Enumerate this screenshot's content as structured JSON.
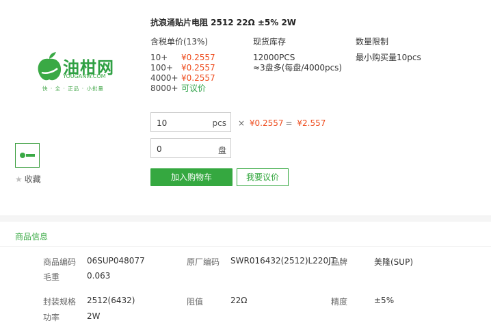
{
  "brand": {
    "name": "油柑网",
    "domain": "YOUGANW.COM",
    "slogan": "快 · 全 · 正品 · 小批量"
  },
  "product": {
    "title": "抗浪涌贴片电阻 2512 22Ω ±5% 2W"
  },
  "columns": {
    "price_head": "含税单价(13%)",
    "stock_head": "现货库存",
    "limit_head": "数量限制"
  },
  "price_tiers": [
    {
      "qty": "10+",
      "price": "¥0.2557"
    },
    {
      "qty": "100+",
      "price": "¥0.2557"
    },
    {
      "qty": "4000+",
      "price": "¥0.2557"
    },
    {
      "qty": "8000+",
      "price": "可议价"
    }
  ],
  "stock": {
    "count": "12000PCS",
    "reels": "≈3盘多(每盘/4000pcs)"
  },
  "limit": {
    "text": "最小购买量10pcs"
  },
  "order": {
    "qty_value": "10",
    "qty_unit": "pcs",
    "reel_value": "0",
    "reel_unit": "盘",
    "multiply": "×",
    "unit_price": "¥0.2557",
    "equals": "=",
    "total": "¥2.557"
  },
  "actions": {
    "favorite": "收藏",
    "add_to_cart": "加入购物车",
    "request_quote": "我要议价"
  },
  "info": {
    "section_title": "商品信息",
    "rows": [
      {
        "label": "商品编码",
        "value": "06SUP048077"
      },
      {
        "label": "原厂编码",
        "value": "SWR016432(2512)L220JT"
      },
      {
        "label": "品牌",
        "value": "美隆(SUP)"
      },
      {
        "label": "毛重",
        "value": "0.063"
      },
      {
        "label": "封装规格",
        "value": "2512(6432)"
      },
      {
        "label": "阻值",
        "value": "22Ω"
      },
      {
        "label": "精度",
        "value": "±5%"
      },
      {
        "label": "功率",
        "value": "2W"
      }
    ]
  },
  "colors": {
    "accent_green": "#35a840",
    "price_orange": "#ee4a1b"
  }
}
